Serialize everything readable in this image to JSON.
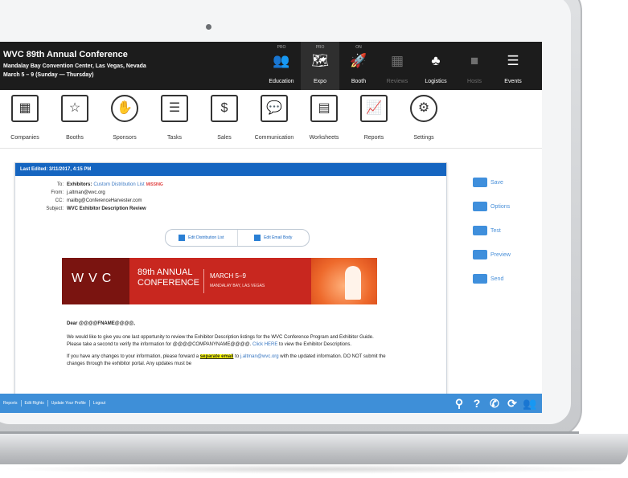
{
  "header": {
    "title": "WVC 89th Annual Conference",
    "venue": "Mandalay Bay Convention Center, Las Vegas, Nevada",
    "dates": "March 5 – 9 (Sunday — Thursday)"
  },
  "top_nav": [
    {
      "tag": "PRO",
      "label": "Education",
      "icon": "people-icon",
      "glyph": "👥"
    },
    {
      "tag": "PRO",
      "label": "Expo",
      "icon": "map-icon",
      "glyph": "🗺"
    },
    {
      "tag": "ON",
      "label": "Booth",
      "icon": "rocket-icon",
      "glyph": "🚀"
    },
    {
      "tag": "",
      "label": "Reviews",
      "icon": "chat-icon",
      "glyph": "▦"
    },
    {
      "tag": "",
      "label": "Logistics",
      "icon": "network-icon",
      "glyph": "♣"
    },
    {
      "tag": "",
      "label": "Hosts",
      "icon": "briefcase-icon",
      "glyph": "■"
    },
    {
      "tag": "",
      "label": "Events",
      "icon": "list-icon",
      "glyph": "☰"
    }
  ],
  "modules": [
    {
      "label": "Companies",
      "icon": "building-icon",
      "glyph": "▦"
    },
    {
      "label": "Booths",
      "icon": "booth-grid-icon",
      "glyph": "☆"
    },
    {
      "label": "Sponsors",
      "icon": "handshake-icon",
      "glyph": "✋"
    },
    {
      "label": "Tasks",
      "icon": "checklist-icon",
      "glyph": "☰"
    },
    {
      "label": "Sales",
      "icon": "dollar-icon",
      "glyph": "$"
    },
    {
      "label": "Communication",
      "icon": "speech-bubbles-icon",
      "glyph": "💬"
    },
    {
      "label": "Worksheets",
      "icon": "worksheet-icon",
      "glyph": "▤"
    },
    {
      "label": "Reports",
      "icon": "line-chart-icon",
      "glyph": "📈"
    },
    {
      "label": "Settings",
      "icon": "gear-icon",
      "glyph": "⚙"
    }
  ],
  "email": {
    "last_edited": "Last Edited: 3/11/2017, 4:15 PM",
    "to_label": "To:",
    "to_value": "Exhibitors:",
    "to_list": "Custom Distribution List",
    "to_warning": "MISSING",
    "from_label": "From:",
    "from_value": "j.altman@wvc.org",
    "cc_label": "CC:",
    "cc_value": "mailbg@ConferenceHarvester.com",
    "subject_label": "Subject:",
    "subject_value": "WVC Exhibitor Description Review",
    "edit_distribution": "Edit Distribution List",
    "edit_body": "Edit Email Body",
    "banner": {
      "logo": "WVC",
      "annual_line1": "89th ANNUAL",
      "annual_line2": "CONFERENCE",
      "date": "MARCH 5–9",
      "venue": "MANDALAY BAY, LAS VEGAS"
    },
    "greeting": "Dear @@@@FNAME@@@@,",
    "para1_a": "We would like to give you one last opportunity to review the Exhibitor Description listings for the WVC Conference Program and Exhibitor Guide.  Please take a second to verify the information for @@@@COMPANYNAME@@@@.",
    "para1_link": "Click HERE",
    "para1_b": "to view the Exhibitor Descriptions.",
    "para2_a": "If you have any changes to your information, please forward a",
    "para2_hl": "separate email",
    "para2_b": "to",
    "para2_email": "j.altman@wvc.org",
    "para2_c": "with the updated information.  DO NOT submit the changes through the exhibitor portal.  Any updates must be"
  },
  "side_actions": [
    {
      "label": "Save",
      "icon": "save-icon"
    },
    {
      "label": "Options",
      "icon": "options-icon"
    },
    {
      "label": "Test",
      "icon": "test-send-icon"
    },
    {
      "label": "Preview",
      "icon": "preview-icon"
    },
    {
      "label": "Send",
      "icon": "send-icon"
    }
  ],
  "bottom_links": [
    "Reports",
    "Edit Rights",
    "Update Your Profile",
    "Logout"
  ],
  "bottom_icons": [
    {
      "name": "search-icon",
      "glyph": "⚲"
    },
    {
      "name": "help-icon",
      "glyph": "?"
    },
    {
      "name": "phone-icon",
      "glyph": "✆"
    },
    {
      "name": "refresh-icon",
      "glyph": "⟳"
    },
    {
      "name": "users-icon",
      "glyph": "👥"
    }
  ],
  "colors": {
    "header_bg": "#1c1c1c",
    "accent": "#1565c0",
    "bottom_bar": "#3e8fd8",
    "banner": "#c8271f"
  }
}
